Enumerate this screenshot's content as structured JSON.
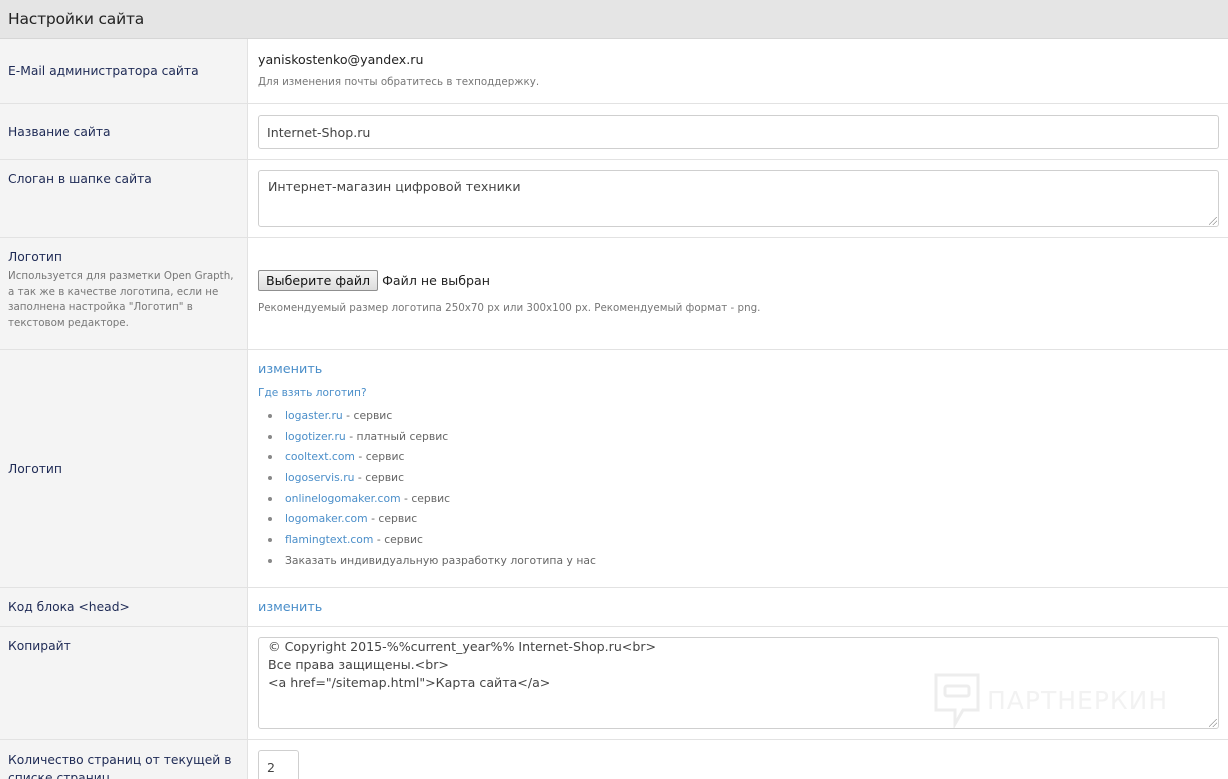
{
  "header": {
    "title": "Настройки сайта"
  },
  "admin_email": {
    "label": "E-Mail администратора сайта",
    "value": "yaniskostenko@yandex.ru",
    "note": "Для изменения почты обратитесь в техподдержку."
  },
  "site_name": {
    "label": "Название сайта",
    "value": "Internet-Shop.ru"
  },
  "slogan": {
    "label": "Слоган в шапке сайта",
    "value": "Интернет-магазин цифровой техники"
  },
  "logo_upload": {
    "label": "Логотип",
    "description": "Используется для разметки Open Grapth, а так же в качестве логотипа, если не заполнена настройка \"Логотип\" в текстовом редакторе.",
    "button_label": "Выберите файл",
    "file_status": "Файл не выбран",
    "hint": "Рекомендуемый размер логотипа 250x70 px или 300x100 px. Рекомендуемый формат - png."
  },
  "logo_editor": {
    "label": "Логотип",
    "change_link": "изменить",
    "where_link": "Где взять логотип?",
    "services": [
      {
        "link": "logaster.ru",
        "desc": " - сервис"
      },
      {
        "link": "logotizer.ru",
        "desc": " - платный сервис"
      },
      {
        "link": "cooltext.com",
        "desc": " - сервис"
      },
      {
        "link": "logoservis.ru",
        "desc": " - сервис"
      },
      {
        "link": "onlinelogomaker.com",
        "desc": " - сервис"
      },
      {
        "link": "logomaker.com",
        "desc": " - сервис"
      },
      {
        "link": "flamingtext.com",
        "desc": " - сервис"
      },
      {
        "link": "",
        "desc": "Заказать индивидуальную разработку логотипа у нас"
      }
    ]
  },
  "head_code": {
    "label": "Код блока <head>",
    "change_link": "изменить"
  },
  "copyright": {
    "label": "Копирайт",
    "line1": "© Copyright 2015-%%current_year%% Internet-Shop.ru<br>",
    "line2": "Все права защищены.<br>",
    "line3": "<a href=\"/sitemap.html\">Карта сайта</a>"
  },
  "pages_count": {
    "label": "Количество страниц от текущей в списке страниц",
    "value": "2"
  },
  "watermark": {
    "text": "ПАРТНЕРКИН"
  }
}
